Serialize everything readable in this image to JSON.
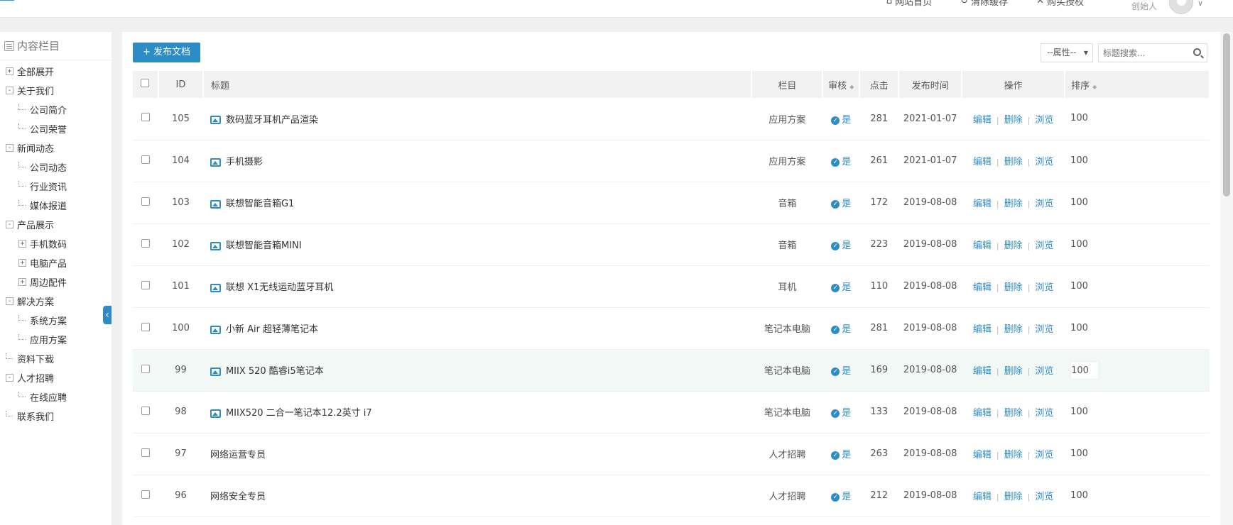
{
  "topbar": {
    "nav": [
      "网站首页",
      "清除缓存",
      "购买授权"
    ],
    "user_role": "创始人"
  },
  "sidebar": {
    "title": "内容栏目",
    "items": [
      {
        "label": "全部展开",
        "toggle": "+"
      },
      {
        "label": "关于我们",
        "toggle": "-"
      },
      {
        "label": "公司简介"
      },
      {
        "label": "公司荣誉"
      },
      {
        "label": "新闻动态",
        "toggle": "-"
      },
      {
        "label": "公司动态"
      },
      {
        "label": "行业资讯"
      },
      {
        "label": "媒体报道"
      },
      {
        "label": "产品展示",
        "toggle": "-"
      },
      {
        "label": "手机数码",
        "toggle": "+"
      },
      {
        "label": "电脑产品",
        "toggle": "+"
      },
      {
        "label": "周边配件",
        "toggle": "+"
      },
      {
        "label": "解决方案",
        "toggle": "-"
      },
      {
        "label": "系统方案"
      },
      {
        "label": "应用方案"
      },
      {
        "label": "资料下载"
      },
      {
        "label": "人才招聘",
        "toggle": "-"
      },
      {
        "label": "在线应聘"
      },
      {
        "label": "联系我们"
      }
    ]
  },
  "toolbar": {
    "publish_label": "+ 发布文档",
    "attr_select": "--属性--",
    "search_placeholder": "标题搜索..."
  },
  "table": {
    "headers": {
      "id": "ID",
      "title": "标题",
      "column": "栏目",
      "audit": "审核",
      "clicks": "点击",
      "date": "发布时间",
      "ops": "操作",
      "order": "排序"
    },
    "ops": {
      "edit": "编辑",
      "delete": "删除",
      "view": "浏览"
    },
    "rows": [
      {
        "id": "105",
        "title": "数码蓝牙耳机产品渲染",
        "column": "应用方案",
        "audit": "是",
        "clicks": "281",
        "date": "2021-01-07",
        "order": "100",
        "has_image": true
      },
      {
        "id": "104",
        "title": "手机摄影",
        "column": "应用方案",
        "audit": "是",
        "clicks": "261",
        "date": "2021-01-07",
        "order": "100",
        "has_image": true
      },
      {
        "id": "103",
        "title": "联想智能音箱G1",
        "column": "音箱",
        "audit": "是",
        "clicks": "172",
        "date": "2019-08-08",
        "order": "100",
        "has_image": true
      },
      {
        "id": "102",
        "title": "联想智能音箱MINI",
        "column": "音箱",
        "audit": "是",
        "clicks": "223",
        "date": "2019-08-08",
        "order": "100",
        "has_image": true
      },
      {
        "id": "101",
        "title": "联想 X1无线运动蓝牙耳机",
        "column": "耳机",
        "audit": "是",
        "clicks": "110",
        "date": "2019-08-08",
        "order": "100",
        "has_image": true
      },
      {
        "id": "100",
        "title": "小新 Air 超轻薄笔记本",
        "column": "笔记本电脑",
        "audit": "是",
        "clicks": "281",
        "date": "2019-08-08",
        "order": "100",
        "has_image": true
      },
      {
        "id": "99",
        "title": "MIIX 520 酷睿i5笔记本",
        "column": "笔记本电脑",
        "audit": "是",
        "clicks": "169",
        "date": "2019-08-08",
        "order": "100",
        "has_image": true
      },
      {
        "id": "98",
        "title": "MIIX520 二合一笔记本12.2英寸 i7",
        "column": "笔记本电脑",
        "audit": "是",
        "clicks": "133",
        "date": "2019-08-08",
        "order": "100",
        "has_image": true
      },
      {
        "id": "97",
        "title": "网络运营专员",
        "column": "人才招聘",
        "audit": "是",
        "clicks": "263",
        "date": "2019-08-08",
        "order": "100",
        "has_image": false
      },
      {
        "id": "96",
        "title": "网络安全专员",
        "column": "人才招聘",
        "audit": "是",
        "clicks": "212",
        "date": "2019-08-08",
        "order": "100",
        "has_image": false
      }
    ]
  },
  "colors": {
    "accent": "#2d8cc6",
    "highlight_row": "#f2f8f5"
  }
}
